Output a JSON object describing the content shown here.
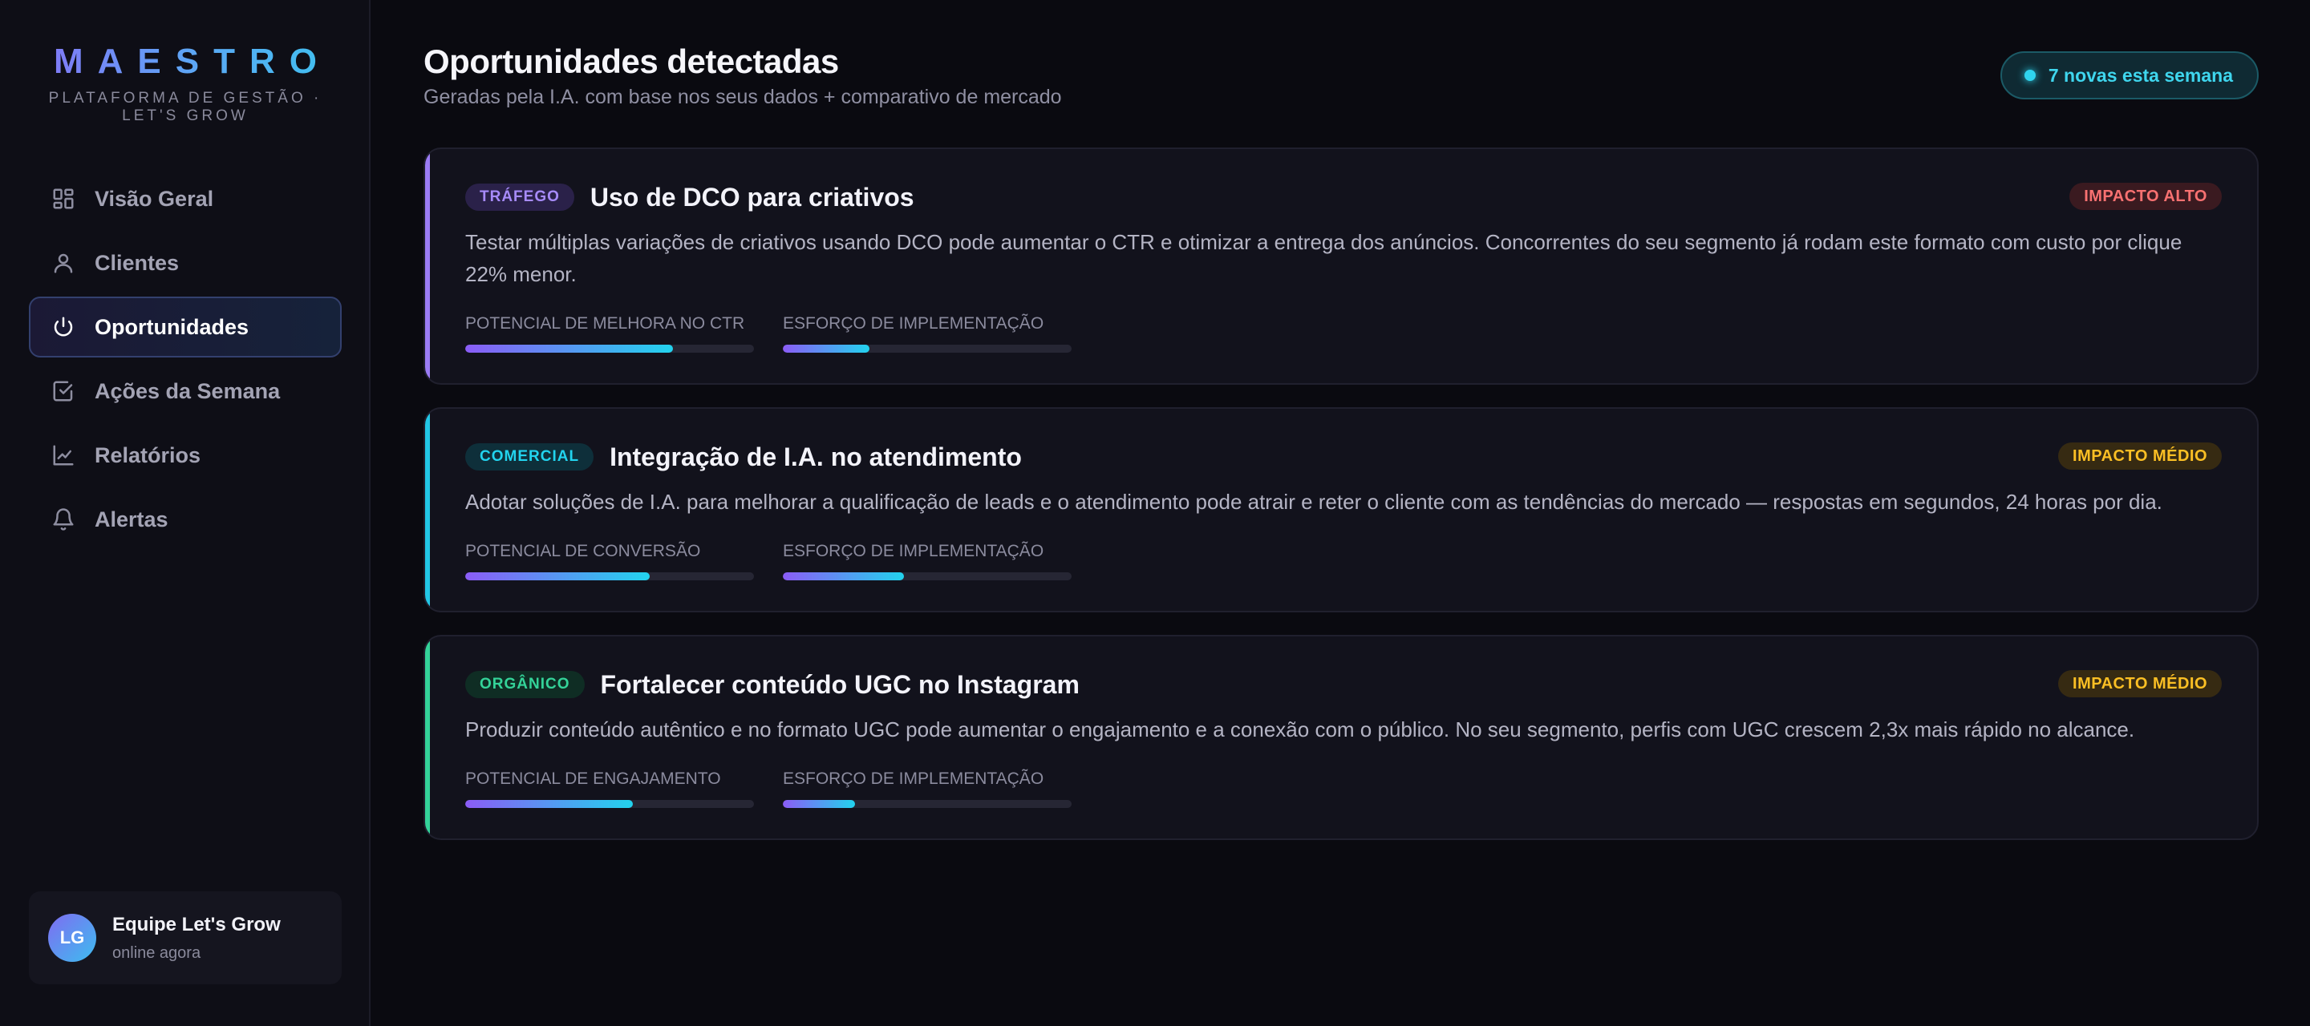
{
  "brand": {
    "logo": "MAESTRO",
    "subtitle": "PLATAFORMA DE GESTÃO · LET'S GROW"
  },
  "sidebar": {
    "items": [
      {
        "label": "Visão Geral",
        "icon": "dashboard-icon",
        "active": false
      },
      {
        "label": "Clientes",
        "icon": "user-icon",
        "active": false
      },
      {
        "label": "Oportunidades",
        "icon": "power-icon",
        "active": true
      },
      {
        "label": "Ações da Semana",
        "icon": "checkbox-icon",
        "active": false
      },
      {
        "label": "Relatórios",
        "icon": "chart-line-icon",
        "active": false
      },
      {
        "label": "Alertas",
        "icon": "bell-icon",
        "active": false
      }
    ],
    "user": {
      "initials": "LG",
      "name": "Equipe Let's Grow",
      "status": "online agora"
    }
  },
  "header": {
    "title": "Oportunidades detectadas",
    "subtitle": "Geradas pela I.A. com base nos seus dados + comparativo de mercado",
    "badge": "7 novas esta semana"
  },
  "cards": [
    {
      "tag": "TRÁFEGO",
      "tag_color": "#a78bfa",
      "tag_bg": "#2a2149",
      "accent": "#9b7cf5",
      "title": "Uso de DCO para criativos",
      "impact": "IMPACTO ALTO",
      "impact_color": "#f87171",
      "impact_bg": "#3a1a20",
      "description": "Testar múltiplas variações de criativos usando DCO pode aumentar o CTR e otimizar a entrega dos anúncios. Concorrentes do seu segmento já rodam este formato com custo por clique 22% menor.",
      "metrics": [
        {
          "label": "Potencial de melhora no CTR",
          "value": 0.72
        },
        {
          "label": "Esforço de implementação",
          "value": 0.3
        }
      ]
    },
    {
      "tag": "COMERCIAL",
      "tag_color": "#22d3ee",
      "tag_bg": "#0e2f3a",
      "accent": "#22c7e6",
      "title": "Integração de I.A. no atendimento",
      "impact": "IMPACTO MÉDIO",
      "impact_color": "#fbbf24",
      "impact_bg": "#362a12",
      "description": "Adotar soluções de I.A. para melhorar a qualificação de leads e o atendimento pode atrair e reter o cliente com as tendências do mercado — respostas em segundos, 24 horas por dia.",
      "metrics": [
        {
          "label": "Potencial de conversão",
          "value": 0.64
        },
        {
          "label": "Esforço de implementação",
          "value": 0.42
        }
      ]
    },
    {
      "tag": "ORGÂNICO",
      "tag_color": "#34d399",
      "tag_bg": "#0f2d24",
      "accent": "#34d399",
      "title": "Fortalecer conteúdo UGC no Instagram",
      "impact": "IMPACTO MÉDIO",
      "impact_color": "#fbbf24",
      "impact_bg": "#362a12",
      "description": "Produzir conteúdo autêntico e no formato UGC pode aumentar o engajamento e a conexão com o público. No seu segmento, perfis com UGC crescem 2,3x mais rápido no alcance.",
      "metrics": [
        {
          "label": "Potencial de engajamento",
          "value": 0.58
        },
        {
          "label": "Esforço de implementação",
          "value": 0.25
        }
      ]
    }
  ]
}
